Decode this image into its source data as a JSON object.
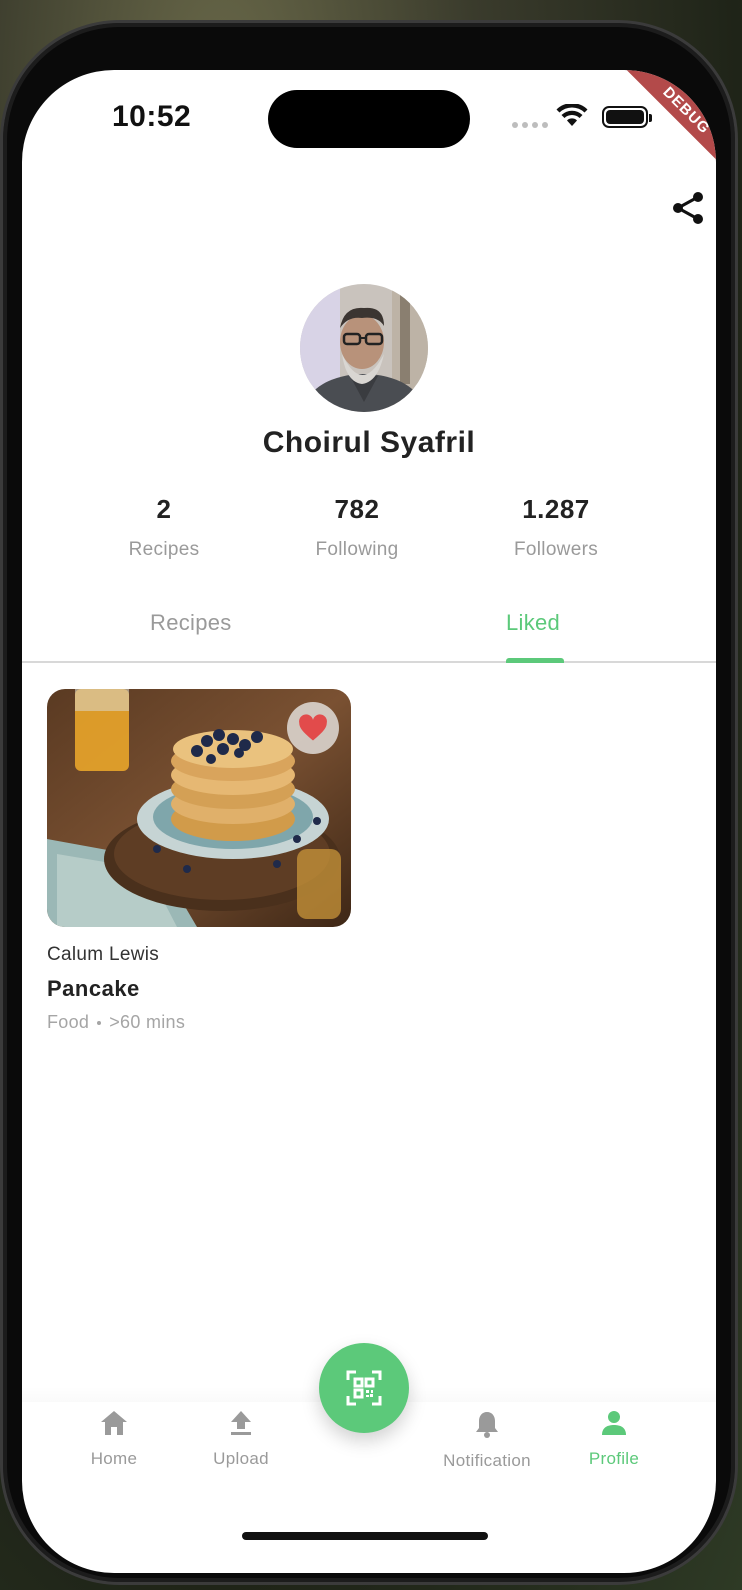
{
  "status_bar": {
    "time": "10:52",
    "debug_banner": "DEBUG"
  },
  "profile": {
    "name": "Choirul Syafril",
    "stats": [
      {
        "value": "2",
        "label": "Recipes"
      },
      {
        "value": "782",
        "label": "Following"
      },
      {
        "value": "1.287",
        "label": "Followers"
      }
    ]
  },
  "tabs": [
    {
      "label": "Recipes",
      "selected": false
    },
    {
      "label": "Liked",
      "selected": true
    }
  ],
  "liked_recipes": [
    {
      "author": "Calum Lewis",
      "title": "Pancake",
      "category": "Food",
      "duration": ">60 mins",
      "liked": true
    }
  ],
  "bottom_nav": {
    "items": [
      {
        "label": "Home",
        "icon": "home-icon"
      },
      {
        "label": "Upload",
        "icon": "upload-icon"
      },
      {
        "label": "Notification",
        "icon": "bell-icon"
      },
      {
        "label": "Profile",
        "icon": "person-icon",
        "active": true
      }
    ],
    "center_action_icon": "qr-scan-icon"
  },
  "colors": {
    "accent": "#5cc97a",
    "muted_text": "#9a9a9a",
    "debug_banner": "#b34a4a",
    "heart": "#e24b4b"
  }
}
